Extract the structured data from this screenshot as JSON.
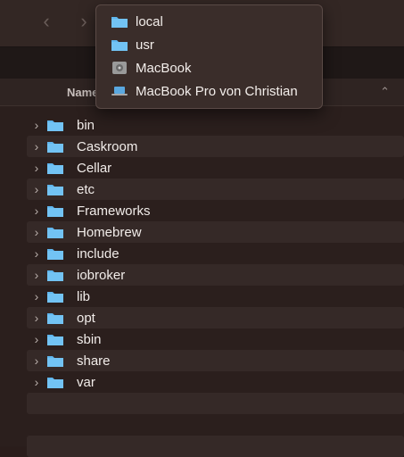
{
  "popup": {
    "items": [
      {
        "label": "local",
        "icon": "folder-icon"
      },
      {
        "label": "usr",
        "icon": "folder-icon"
      },
      {
        "label": "MacBook",
        "icon": "hard-drive-icon"
      },
      {
        "label": "MacBook Pro von Christian",
        "icon": "laptop-icon"
      }
    ]
  },
  "header": {
    "name_label": "Name"
  },
  "files": [
    {
      "label": "bin"
    },
    {
      "label": "Caskroom"
    },
    {
      "label": "Cellar"
    },
    {
      "label": "etc"
    },
    {
      "label": "Frameworks"
    },
    {
      "label": "Homebrew"
    },
    {
      "label": "include"
    },
    {
      "label": "iobroker"
    },
    {
      "label": "lib"
    },
    {
      "label": "opt"
    },
    {
      "label": "sbin"
    },
    {
      "label": "share"
    },
    {
      "label": "var"
    }
  ],
  "colors": {
    "folder": "#5fb6ee",
    "accent": "#3a9bdc"
  }
}
